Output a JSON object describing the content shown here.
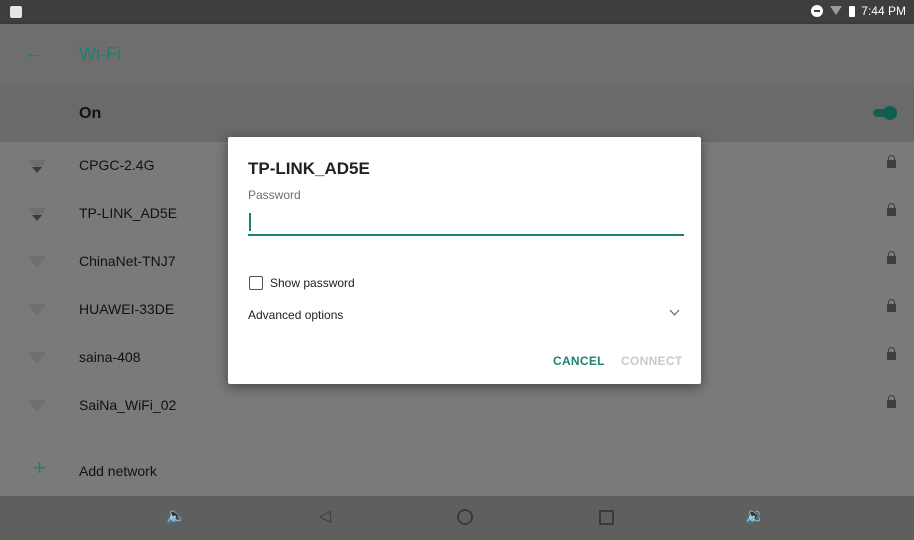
{
  "status_bar": {
    "time": "7:44 PM"
  },
  "app_bar": {
    "title": "Wi-Fi"
  },
  "wifi_toggle": {
    "label": "On",
    "state": "on",
    "accent": "#1e8073"
  },
  "networks": [
    {
      "name": "CPGC-2.4G",
      "signal": "weak"
    },
    {
      "name": "TP-LINK_AD5E",
      "signal": "strong"
    },
    {
      "name": "ChinaNet-TNJ7",
      "signal": "weak"
    },
    {
      "name": "HUAWEI-33DE",
      "signal": "weak"
    },
    {
      "name": "saina-408",
      "signal": "weak"
    },
    {
      "name": "SaiNa_WiFi_02",
      "signal": "weak"
    }
  ],
  "add_network": {
    "label": "Add network"
  },
  "dialog": {
    "title": "TP-LINK_AD5E",
    "password_label": "Password",
    "password_value": "",
    "show_password_label": "Show password",
    "show_password_checked": false,
    "advanced_label": "Advanced options",
    "cancel_label": "CANCEL",
    "connect_label": "CONNECT"
  },
  "colors": {
    "accent": "#1e8073",
    "disabled": "#c9c9c9"
  }
}
